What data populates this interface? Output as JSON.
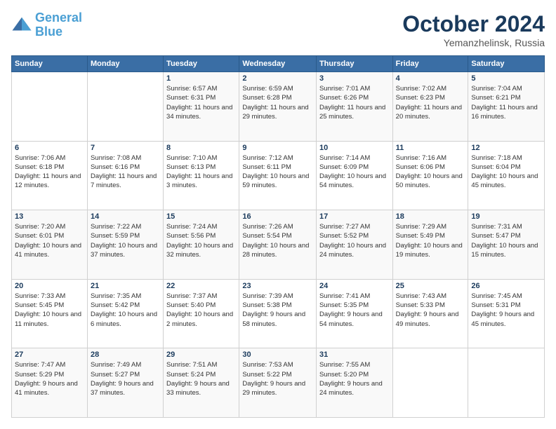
{
  "logo": {
    "line1": "General",
    "line2": "Blue"
  },
  "title": "October 2024",
  "subtitle": "Yemanzhelinsk, Russia",
  "days_header": [
    "Sunday",
    "Monday",
    "Tuesday",
    "Wednesday",
    "Thursday",
    "Friday",
    "Saturday"
  ],
  "weeks": [
    [
      {
        "day": "",
        "sunrise": "",
        "sunset": "",
        "daylight": ""
      },
      {
        "day": "",
        "sunrise": "",
        "sunset": "",
        "daylight": ""
      },
      {
        "day": "1",
        "sunrise": "Sunrise: 6:57 AM",
        "sunset": "Sunset: 6:31 PM",
        "daylight": "Daylight: 11 hours and 34 minutes."
      },
      {
        "day": "2",
        "sunrise": "Sunrise: 6:59 AM",
        "sunset": "Sunset: 6:28 PM",
        "daylight": "Daylight: 11 hours and 29 minutes."
      },
      {
        "day": "3",
        "sunrise": "Sunrise: 7:01 AM",
        "sunset": "Sunset: 6:26 PM",
        "daylight": "Daylight: 11 hours and 25 minutes."
      },
      {
        "day": "4",
        "sunrise": "Sunrise: 7:02 AM",
        "sunset": "Sunset: 6:23 PM",
        "daylight": "Daylight: 11 hours and 20 minutes."
      },
      {
        "day": "5",
        "sunrise": "Sunrise: 7:04 AM",
        "sunset": "Sunset: 6:21 PM",
        "daylight": "Daylight: 11 hours and 16 minutes."
      }
    ],
    [
      {
        "day": "6",
        "sunrise": "Sunrise: 7:06 AM",
        "sunset": "Sunset: 6:18 PM",
        "daylight": "Daylight: 11 hours and 12 minutes."
      },
      {
        "day": "7",
        "sunrise": "Sunrise: 7:08 AM",
        "sunset": "Sunset: 6:16 PM",
        "daylight": "Daylight: 11 hours and 7 minutes."
      },
      {
        "day": "8",
        "sunrise": "Sunrise: 7:10 AM",
        "sunset": "Sunset: 6:13 PM",
        "daylight": "Daylight: 11 hours and 3 minutes."
      },
      {
        "day": "9",
        "sunrise": "Sunrise: 7:12 AM",
        "sunset": "Sunset: 6:11 PM",
        "daylight": "Daylight: 10 hours and 59 minutes."
      },
      {
        "day": "10",
        "sunrise": "Sunrise: 7:14 AM",
        "sunset": "Sunset: 6:09 PM",
        "daylight": "Daylight: 10 hours and 54 minutes."
      },
      {
        "day": "11",
        "sunrise": "Sunrise: 7:16 AM",
        "sunset": "Sunset: 6:06 PM",
        "daylight": "Daylight: 10 hours and 50 minutes."
      },
      {
        "day": "12",
        "sunrise": "Sunrise: 7:18 AM",
        "sunset": "Sunset: 6:04 PM",
        "daylight": "Daylight: 10 hours and 45 minutes."
      }
    ],
    [
      {
        "day": "13",
        "sunrise": "Sunrise: 7:20 AM",
        "sunset": "Sunset: 6:01 PM",
        "daylight": "Daylight: 10 hours and 41 minutes."
      },
      {
        "day": "14",
        "sunrise": "Sunrise: 7:22 AM",
        "sunset": "Sunset: 5:59 PM",
        "daylight": "Daylight: 10 hours and 37 minutes."
      },
      {
        "day": "15",
        "sunrise": "Sunrise: 7:24 AM",
        "sunset": "Sunset: 5:56 PM",
        "daylight": "Daylight: 10 hours and 32 minutes."
      },
      {
        "day": "16",
        "sunrise": "Sunrise: 7:26 AM",
        "sunset": "Sunset: 5:54 PM",
        "daylight": "Daylight: 10 hours and 28 minutes."
      },
      {
        "day": "17",
        "sunrise": "Sunrise: 7:27 AM",
        "sunset": "Sunset: 5:52 PM",
        "daylight": "Daylight: 10 hours and 24 minutes."
      },
      {
        "day": "18",
        "sunrise": "Sunrise: 7:29 AM",
        "sunset": "Sunset: 5:49 PM",
        "daylight": "Daylight: 10 hours and 19 minutes."
      },
      {
        "day": "19",
        "sunrise": "Sunrise: 7:31 AM",
        "sunset": "Sunset: 5:47 PM",
        "daylight": "Daylight: 10 hours and 15 minutes."
      }
    ],
    [
      {
        "day": "20",
        "sunrise": "Sunrise: 7:33 AM",
        "sunset": "Sunset: 5:45 PM",
        "daylight": "Daylight: 10 hours and 11 minutes."
      },
      {
        "day": "21",
        "sunrise": "Sunrise: 7:35 AM",
        "sunset": "Sunset: 5:42 PM",
        "daylight": "Daylight: 10 hours and 6 minutes."
      },
      {
        "day": "22",
        "sunrise": "Sunrise: 7:37 AM",
        "sunset": "Sunset: 5:40 PM",
        "daylight": "Daylight: 10 hours and 2 minutes."
      },
      {
        "day": "23",
        "sunrise": "Sunrise: 7:39 AM",
        "sunset": "Sunset: 5:38 PM",
        "daylight": "Daylight: 9 hours and 58 minutes."
      },
      {
        "day": "24",
        "sunrise": "Sunrise: 7:41 AM",
        "sunset": "Sunset: 5:35 PM",
        "daylight": "Daylight: 9 hours and 54 minutes."
      },
      {
        "day": "25",
        "sunrise": "Sunrise: 7:43 AM",
        "sunset": "Sunset: 5:33 PM",
        "daylight": "Daylight: 9 hours and 49 minutes."
      },
      {
        "day": "26",
        "sunrise": "Sunrise: 7:45 AM",
        "sunset": "Sunset: 5:31 PM",
        "daylight": "Daylight: 9 hours and 45 minutes."
      }
    ],
    [
      {
        "day": "27",
        "sunrise": "Sunrise: 7:47 AM",
        "sunset": "Sunset: 5:29 PM",
        "daylight": "Daylight: 9 hours and 41 minutes."
      },
      {
        "day": "28",
        "sunrise": "Sunrise: 7:49 AM",
        "sunset": "Sunset: 5:27 PM",
        "daylight": "Daylight: 9 hours and 37 minutes."
      },
      {
        "day": "29",
        "sunrise": "Sunrise: 7:51 AM",
        "sunset": "Sunset: 5:24 PM",
        "daylight": "Daylight: 9 hours and 33 minutes."
      },
      {
        "day": "30",
        "sunrise": "Sunrise: 7:53 AM",
        "sunset": "Sunset: 5:22 PM",
        "daylight": "Daylight: 9 hours and 29 minutes."
      },
      {
        "day": "31",
        "sunrise": "Sunrise: 7:55 AM",
        "sunset": "Sunset: 5:20 PM",
        "daylight": "Daylight: 9 hours and 24 minutes."
      },
      {
        "day": "",
        "sunrise": "",
        "sunset": "",
        "daylight": ""
      },
      {
        "day": "",
        "sunrise": "",
        "sunset": "",
        "daylight": ""
      }
    ]
  ]
}
